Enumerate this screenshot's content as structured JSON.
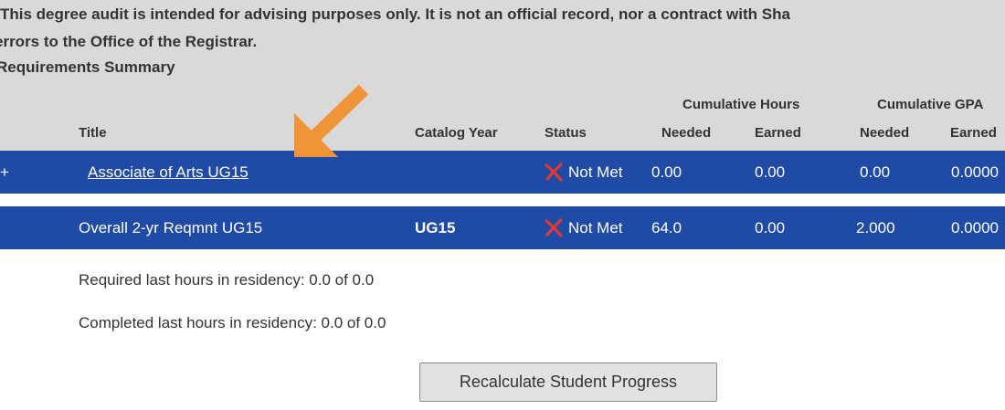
{
  "notice": {
    "line1": "This degree audit is intended for advising purposes only. It is not an official record, nor a contract with Sha",
    "line2": "errors to the Office of the Registrar.",
    "section_title": "Requirements Summary"
  },
  "table": {
    "group_headers": {
      "cumulative_hours": "Cumulative Hours",
      "cumulative_gpa": "Cumulative GPA"
    },
    "columns": {
      "title": "Title",
      "catalog_year": "Catalog Year",
      "status": "Status",
      "hours_needed": "Needed",
      "hours_earned": "Earned",
      "gpa_needed": "Needed",
      "gpa_earned": "Earned"
    },
    "rows": [
      {
        "expander": "+",
        "title": "Associate of Arts UG15",
        "catalog_year": "",
        "status": "Not Met",
        "hours_needed": "0.00",
        "hours_earned": "0.00",
        "gpa_needed": "0.00",
        "gpa_earned": "0.0000"
      },
      {
        "title": "Overall 2-yr Reqmnt UG15",
        "catalog_year": "UG15",
        "status": "Not Met",
        "hours_needed": "64.0",
        "hours_earned": "0.00",
        "gpa_needed": "2.000",
        "gpa_earned": "0.0000"
      }
    ]
  },
  "residency": {
    "required": "Required last hours in residency: 0.0 of 0.0",
    "completed": "Completed last hours in residency: 0.0 of 0.0"
  },
  "button": {
    "recalculate": "Recalculate Student Progress"
  },
  "colors": {
    "row_bg": "#1f4aa6",
    "header_bg": "#d9d9d9",
    "arrow": "#f0943a",
    "x_icon": "#e03a2e"
  },
  "icons": {
    "status": "x-mark-icon",
    "pointer": "arrow-icon"
  }
}
